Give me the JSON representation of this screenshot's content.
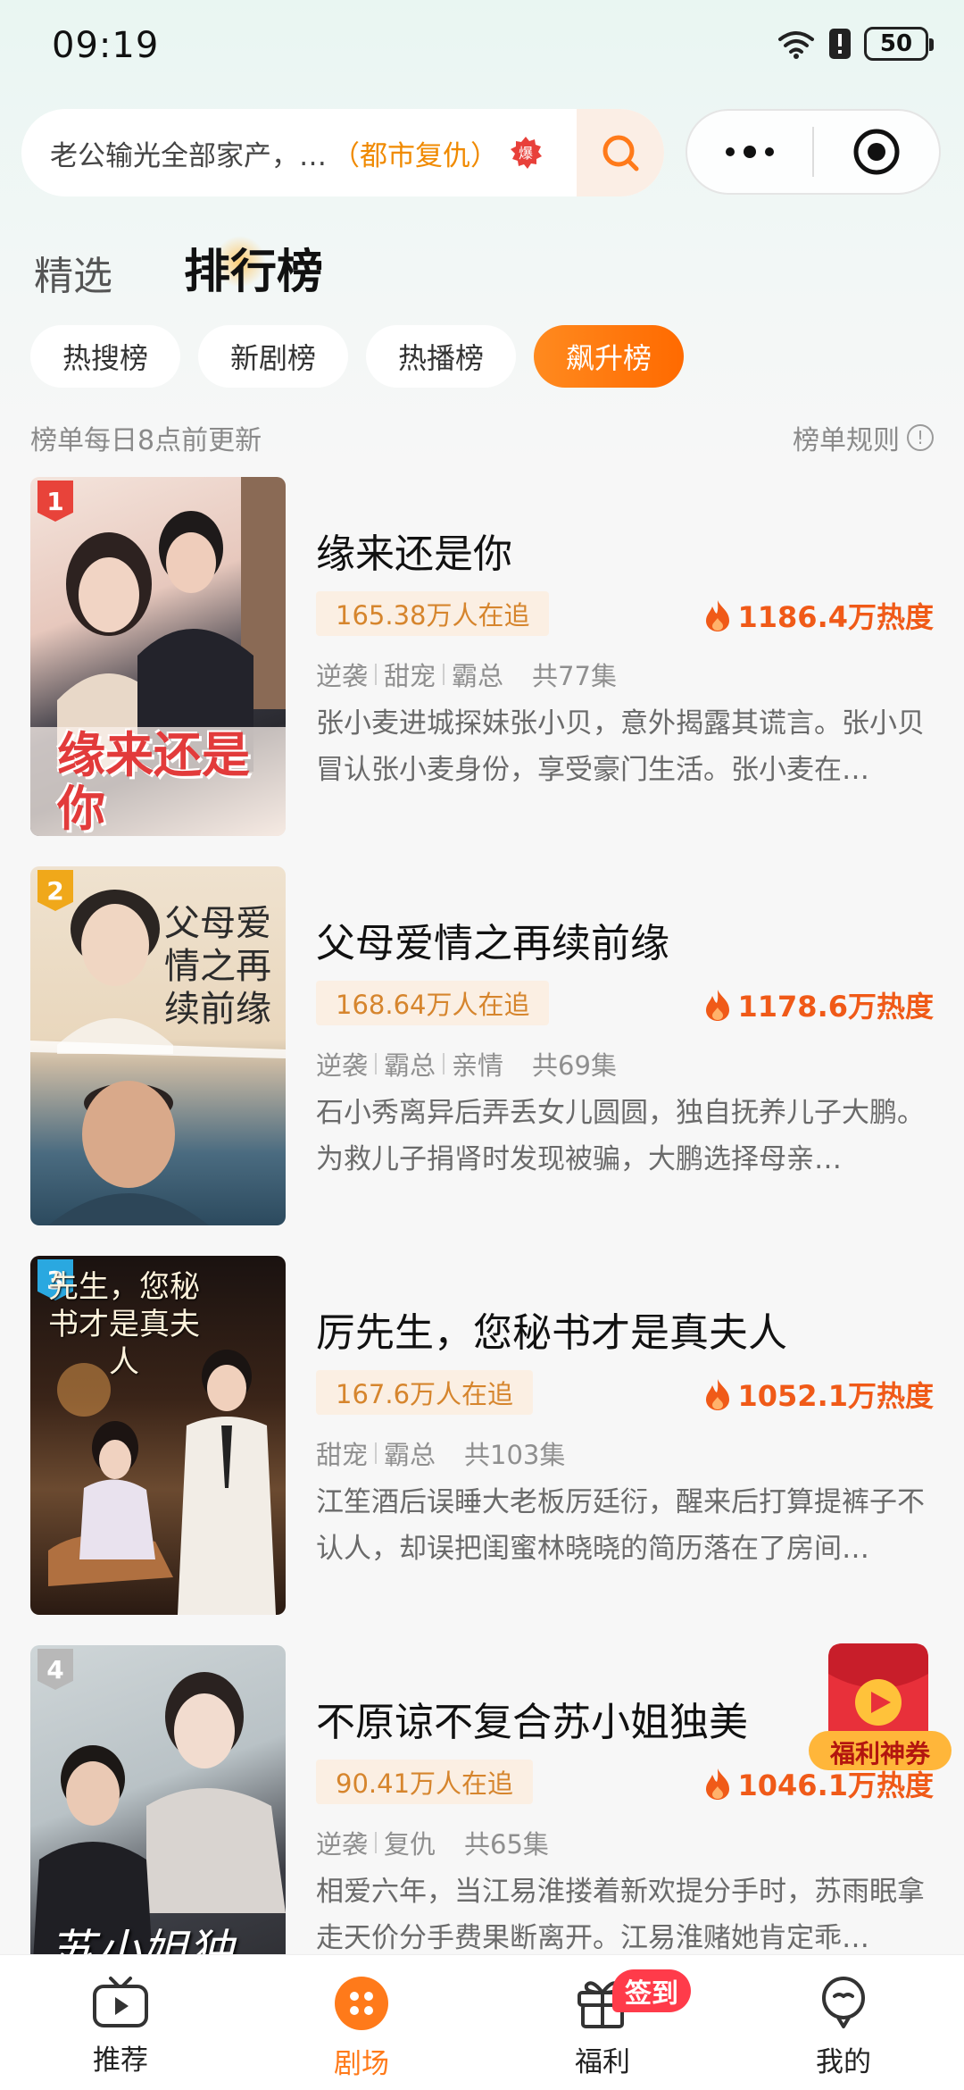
{
  "status_bar": {
    "time": "09:19",
    "battery": "50"
  },
  "search": {
    "query": "老公输光全部家产，…",
    "genre_tag": "（都市复仇）",
    "hot_badge": "爆"
  },
  "top_tabs": {
    "featured": "精选",
    "ranking": "排行榜"
  },
  "chips": [
    {
      "label": "热搜榜",
      "active": false
    },
    {
      "label": "新剧榜",
      "active": false
    },
    {
      "label": "热播榜",
      "active": false
    },
    {
      "label": "飙升榜",
      "active": true
    }
  ],
  "update_note": "榜单每日8点前更新",
  "rules_label": "榜单规则",
  "items": [
    {
      "rank": "1",
      "poster_text": "缘来还是你",
      "title": "缘来还是你",
      "followers": "165.38万人在追",
      "heat": "1186.4万热度",
      "tags": [
        "逆袭",
        "甜宠",
        "霸总"
      ],
      "episodes": "共77集",
      "description": "张小麦进城探妹张小贝，意外揭露其谎言。张小贝冒认张小麦身份，享受豪门生活。张小麦在…"
    },
    {
      "rank": "2",
      "poster_text": "父母爱情之再续前缘",
      "title": "父母爱情之再续前缘",
      "followers": "168.64万人在追",
      "heat": "1178.6万热度",
      "tags": [
        "逆袭",
        "霸总",
        "亲情"
      ],
      "episodes": "共69集",
      "description": "石小秀离异后弄丢女儿圆圆，独自抚养儿子大鹏。为救儿子捐肾时发现被骗，大鹏选择母亲…"
    },
    {
      "rank": "3",
      "poster_text": "先生，您秘书才是真夫人",
      "title": "厉先生，您秘书才是真夫人",
      "followers": "167.6万人在追",
      "heat": "1052.1万热度",
      "tags": [
        "甜宠",
        "霸总"
      ],
      "episodes": "共103集",
      "description": "江笙酒后误睡大老板厉廷衍，醒来后打算提裤子不认人，却误把闺蜜林晓晓的简历落在了房间…"
    },
    {
      "rank": "4",
      "poster_text": "苏小姐独美",
      "title": "不原谅不复合苏小姐独美",
      "followers": "90.41万人在追",
      "heat": "1046.1万热度",
      "tags": [
        "逆袭",
        "复仇"
      ],
      "episodes": "共65集",
      "description": "相爱六年，当江易淮搂着新欢提分手时，苏雨眠拿走天价分手费果断离开。江易淮赌她肯定乖…"
    }
  ],
  "welfare_float": "福利神券",
  "bottom_nav": [
    {
      "label": "推荐",
      "icon": "tv-icon",
      "active": false
    },
    {
      "label": "剧场",
      "icon": "theater-icon",
      "active": true
    },
    {
      "label": "福利",
      "icon": "gift-icon",
      "active": false,
      "badge": "签到"
    },
    {
      "label": "我的",
      "icon": "profile-icon",
      "active": false
    }
  ],
  "colors": {
    "accent": "#ff7a1a",
    "heat": "#f05a18",
    "rank1": "#e8433a",
    "rank2": "#f0a81a",
    "rank3": "#2aa8e0",
    "rank4": "#b8b8b8"
  }
}
